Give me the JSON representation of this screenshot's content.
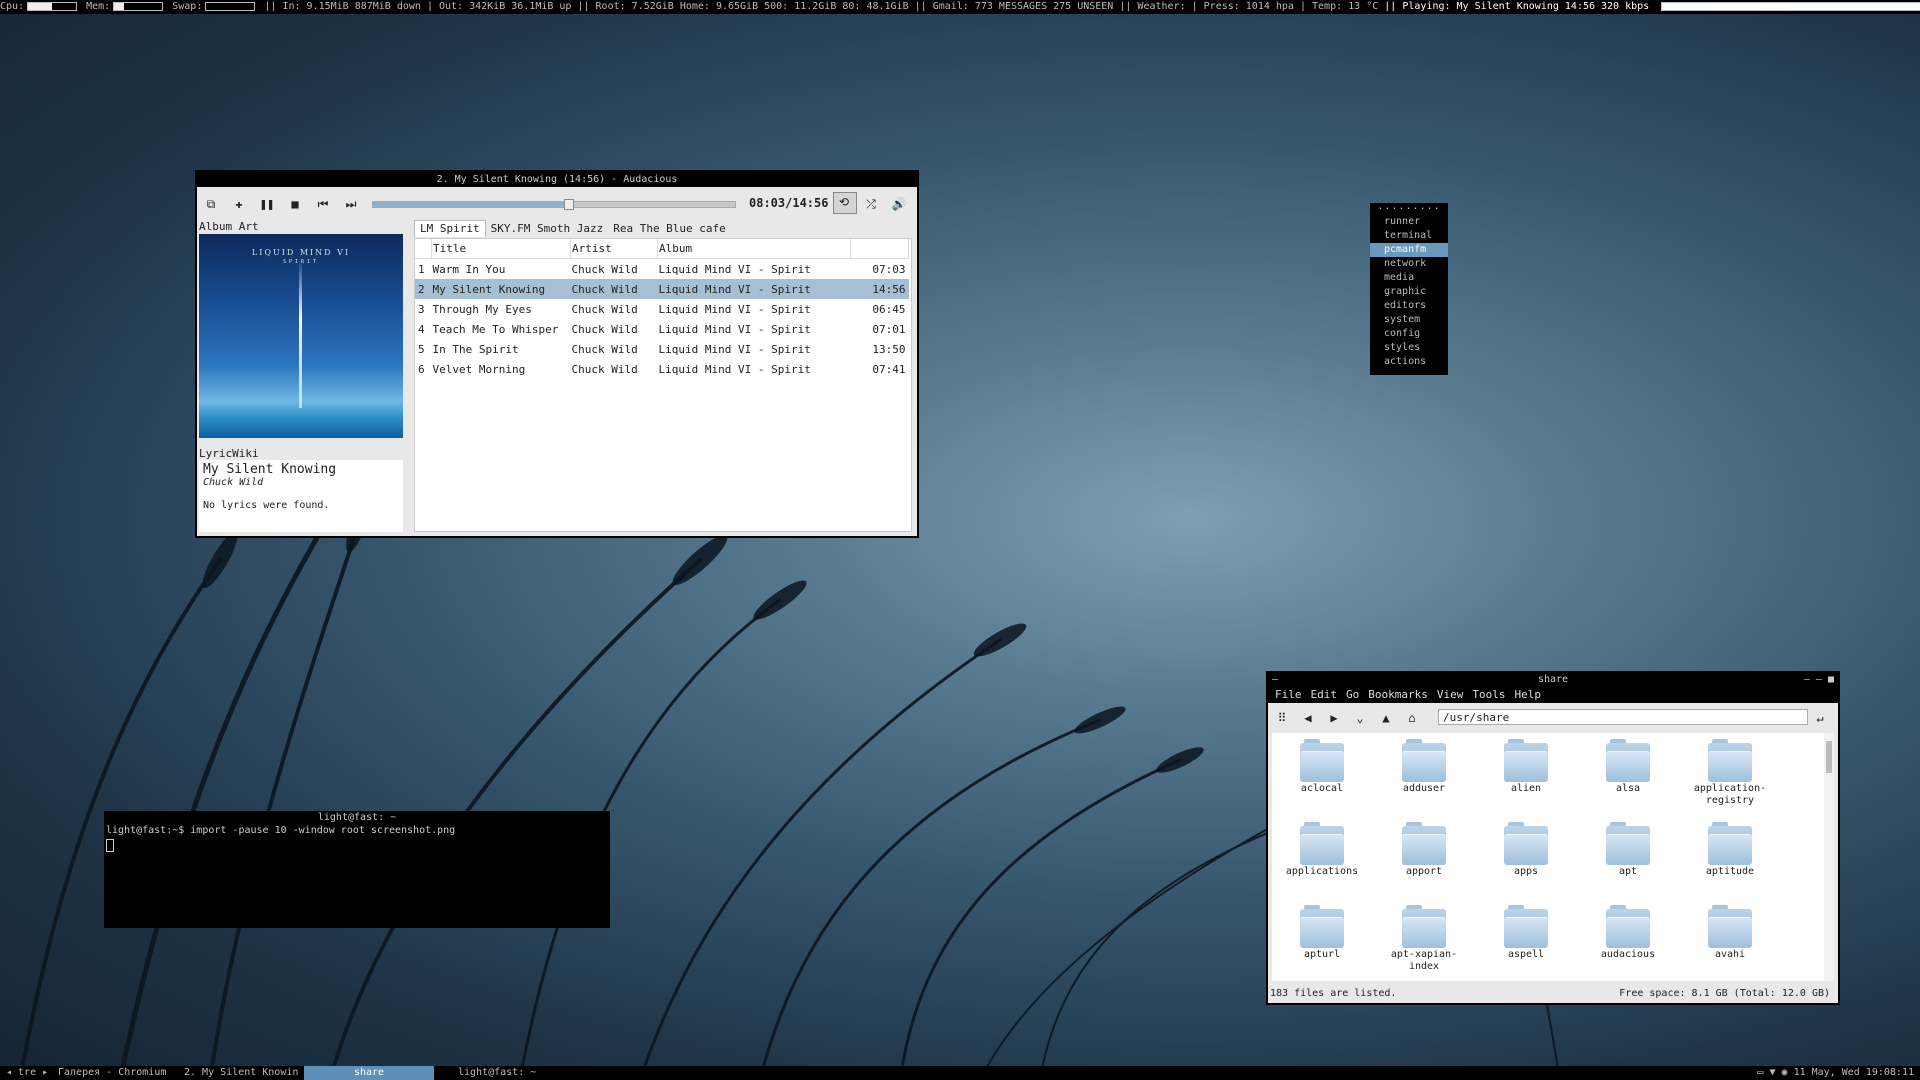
{
  "topbar": {
    "cpu_label": "Cpu:",
    "cpu_level": 0.5,
    "mem_label": "Mem:",
    "mem_level": 0.2,
    "swap_label": "Swap:",
    "swap_level": 0.0,
    "net_in": "|| In: 9.15MiB 887MiB down | Out:  342KiB  36.1MiB up",
    "disks": "|| Root: 7.52GiB Home: 9.65GiB 500: 11.2GiB 80: 48.1GiB",
    "gmail": "|| Gmail:  773 MESSAGES 275 UNSEEN",
    "weather": "|| Weather:  | Press: 1014 hpa | Temp: 13 °C",
    "playing": "|| Playing: My Silent Knowing 14:56 320 kbps",
    "playing_progress": 0.54
  },
  "audacious": {
    "title": "2. My Silent Knowing (14:56) - Audacious",
    "time": "08:03/14:56",
    "progress": 0.54,
    "icons": [
      "open-icon",
      "add-icon",
      "pause-icon",
      "stop-icon",
      "previous-icon",
      "next-icon",
      "repeat-icon",
      "shuffle-icon",
      "volume-icon"
    ],
    "album_art_label": "Album Art",
    "art_text_1": "LIQUID MIND VI",
    "art_text_2": "SPIRIT",
    "lyrics_label": "LyricWiki",
    "lyrics_song": "My Silent Knowing",
    "lyrics_artist": "Chuck Wild",
    "lyrics_msg": "No lyrics were found.",
    "tabs": [
      "LM Spirit",
      "SKY.FM Smoth Jazz",
      "Rea The Blue cafe"
    ],
    "columns": [
      "Title",
      "Artist",
      "Album"
    ],
    "tracks": [
      {
        "n": "1",
        "title": "Warm In You",
        "artist": "Chuck Wild",
        "album": "Liquid Mind VI - Spirit",
        "len": "07:03"
      },
      {
        "n": "2",
        "title": "My Silent Knowing",
        "artist": "Chuck Wild",
        "album": "Liquid Mind VI - Spirit",
        "len": "14:56"
      },
      {
        "n": "3",
        "title": "Through My Eyes",
        "artist": "Chuck Wild",
        "album": "Liquid Mind VI - Spirit",
        "len": "06:45"
      },
      {
        "n": "4",
        "title": "Teach Me To Whisper",
        "artist": "Chuck Wild",
        "album": "Liquid Mind VI - Spirit",
        "len": "07:01"
      },
      {
        "n": "5",
        "title": "In The Spirit",
        "artist": "Chuck Wild",
        "album": "Liquid Mind VI - Spirit",
        "len": "13:50"
      },
      {
        "n": "6",
        "title": "Velvet Morning",
        "artist": "Chuck Wild",
        "album": "Liquid Mind VI - Spirit",
        "len": "07:41"
      }
    ]
  },
  "menu": {
    "dots": ".........",
    "items": [
      "runner",
      "terminal",
      "pcmanfm",
      "network",
      "media",
      "graphic",
      "editors",
      "system",
      "config",
      "styles",
      "actions"
    ],
    "selected": "pcmanfm"
  },
  "terminal": {
    "title": "light@fast: ~",
    "line": "light@fast:~$ import -pause 10 -window root screenshot.png"
  },
  "filemanager": {
    "title": "share",
    "menu": [
      "File",
      "Edit",
      "Go",
      "Bookmarks",
      "View",
      "Tools",
      "Help"
    ],
    "path": "/usr/share",
    "folders": [
      "aclocal",
      "adduser",
      "alien",
      "alsa",
      "application-\nregistry",
      "applications",
      "apport",
      "apps",
      "apt",
      "aptitude",
      "apturl",
      "apt-xapian-\nindex",
      "aspell",
      "audacious",
      "avahi"
    ],
    "status_left": "183 files are listed.",
    "status_right": "Free space: 8.1 GB (Total: 12.0 GB)"
  },
  "taskbar": {
    "start": "◂ tre ▸",
    "tasks": [
      "Галерея - Chromium",
      "2. My Silent Knowin",
      "share",
      "light@fast: ~"
    ],
    "active": "share",
    "clock": "11 May, Wed 19:08:11"
  }
}
